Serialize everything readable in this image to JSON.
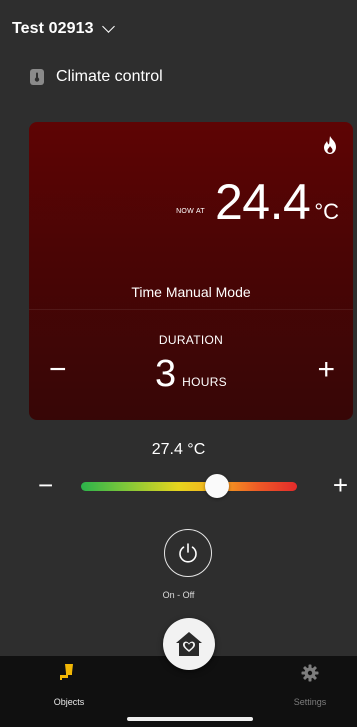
{
  "header": {
    "device_name": "Test 02913"
  },
  "section": {
    "title": "Climate control",
    "icon": "thermometer-icon"
  },
  "climate_card": {
    "status_icon": "flame-icon",
    "now_at_label": "NOW AT",
    "current_temperature": "24.4",
    "temperature_unit": "°C",
    "mode": "Time Manual Mode",
    "duration_label": "DURATION",
    "duration_value": "3",
    "duration_unit": "HOURS",
    "decrease_symbol": "−",
    "increase_symbol": "+"
  },
  "setpoint": {
    "label": "27.4 °C",
    "slider_position": 0.63,
    "decrease_symbol": "−",
    "increase_symbol": "+"
  },
  "power": {
    "label": "On - Off",
    "icon": "power-icon"
  },
  "bottom_nav": {
    "objects_label": "Objects",
    "settings_label": "Settings",
    "home_icon": "home-heart-icon"
  },
  "colors": {
    "background": "#2e2e2e",
    "card_top": "#5e0404",
    "card_bottom": "#370606",
    "nav_bg": "#101010",
    "objects_icon": "#f2b705"
  }
}
